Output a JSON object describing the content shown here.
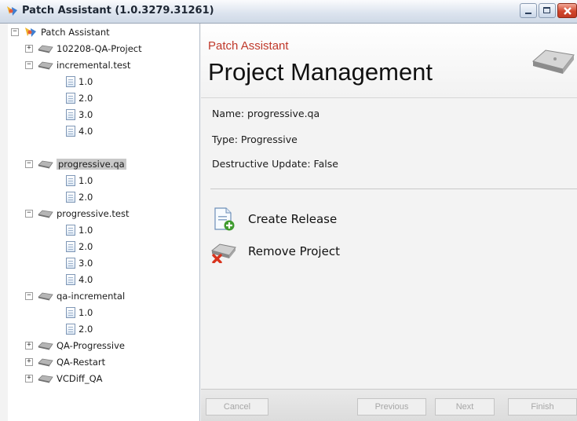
{
  "window": {
    "title": "Patch Assistant (1.0.3279.31261)",
    "close_color": "#d0462d"
  },
  "tree": {
    "root": "Patch Assistant",
    "nodes": [
      {
        "label": "102208-QA-Project",
        "expander": "+",
        "children": []
      },
      {
        "label": "incremental.test",
        "expander": "−",
        "children": [
          "1.0",
          "2.0",
          "3.0",
          "4.0"
        ]
      },
      {
        "label": "progressive.qa",
        "expander": "−",
        "selected": true,
        "children": [
          "1.0",
          "2.0"
        ]
      },
      {
        "label": "progressive.test",
        "expander": "−",
        "children": [
          "1.0",
          "2.0",
          "3.0",
          "4.0"
        ]
      },
      {
        "label": "qa-incremental",
        "expander": "−",
        "children": [
          "1.0",
          "2.0"
        ]
      },
      {
        "label": "QA-Progressive",
        "expander": "+",
        "children": []
      },
      {
        "label": "QA-Restart",
        "expander": "+",
        "children": []
      },
      {
        "label": "VCDiff_QA",
        "expander": "+",
        "children": []
      }
    ]
  },
  "header": {
    "subtitle": "Patch Assistant",
    "title": "Project Management",
    "subtitle_color": "#c0392b"
  },
  "details": {
    "name": "Name: progressive.qa",
    "type": "Type: Progressive",
    "destructive": "Destructive Update: False"
  },
  "actions": {
    "create_release": "Create Release",
    "remove_project": "Remove Project"
  },
  "footer": {
    "cancel": "Cancel",
    "previous": "Previous",
    "next": "Next",
    "finish": "Finish"
  }
}
